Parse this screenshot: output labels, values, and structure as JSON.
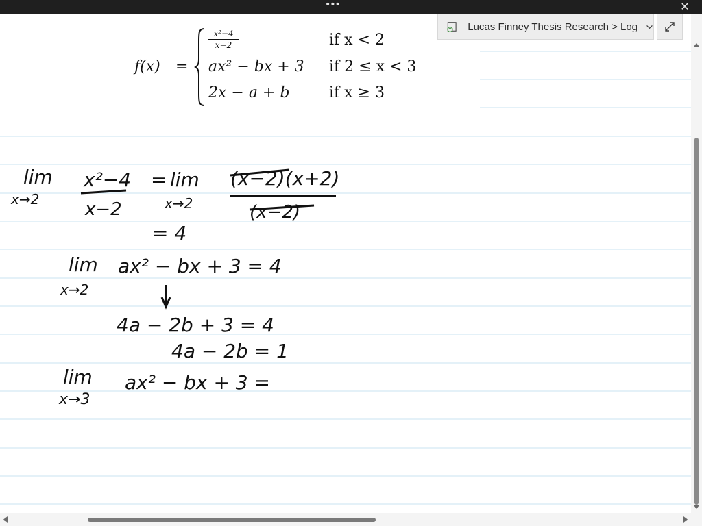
{
  "window": {
    "menu_dots": "•••",
    "close_glyph": "✕"
  },
  "breadcrumb": {
    "text": "Lucas Finney Thesis Research > Log"
  },
  "formula": {
    "lhs": "f(x)",
    "equals": "=",
    "pieces": [
      {
        "numerator": "x²−4",
        "denominator": "x−2",
        "condition": "if x < 2"
      },
      {
        "expression": "ax² − bx + 3",
        "condition": "if 2 ≤ x < 3"
      },
      {
        "expression": "2x − a + b",
        "condition": "if x ≥ 3"
      }
    ]
  },
  "handwriting": {
    "lim_word": "lim",
    "row1_sub": "x→2",
    "row1_num": "x²−4",
    "row1_den": "x−2",
    "row1_eq": "=",
    "row1_num2": "(x−2)(x+2)",
    "row1_den2": "(x−2)",
    "row1_result": "= 4",
    "row2_sub": "x→2",
    "row2_expr": "ax² − bx + 3 = 4",
    "row3": "4a − 2b + 3 = 4",
    "row4": "4a − 2b = 1",
    "row5_sub": "x→3",
    "row5_expr": "ax² − bx + 3 ="
  },
  "icons": {
    "notebook": "notebook-sync-icon",
    "chevron": "chevron-down-icon",
    "expand": "expand-icon"
  }
}
